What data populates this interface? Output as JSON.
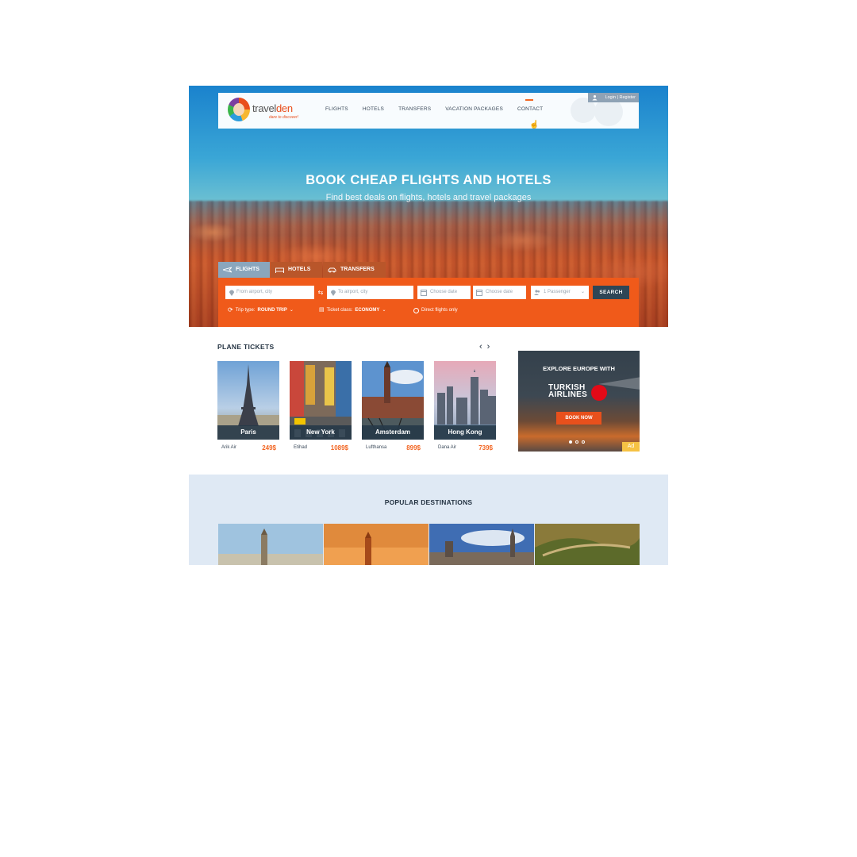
{
  "brand": {
    "name_part1": "travel",
    "name_part2": "den",
    "tagline": "dare to discover!"
  },
  "nav": {
    "items": [
      {
        "label": "FLIGHTS"
      },
      {
        "label": "HOTELS"
      },
      {
        "label": "TRANSFERS"
      },
      {
        "label": "VACATION PACKAGES"
      },
      {
        "label": "CONTACT",
        "active": true
      }
    ],
    "login_label": "Login  |  Register"
  },
  "hero": {
    "title": "BOOK CHEAP FLIGHTS AND HOTELS",
    "subtitle": "Find best deals on flights, hotels and travel packages"
  },
  "search": {
    "tabs": [
      {
        "label": "FLIGHTS",
        "icon": "plane-icon",
        "active": true
      },
      {
        "label": "HOTELS",
        "icon": "bed-icon"
      },
      {
        "label": "TRANSFERS",
        "icon": "car-icon"
      }
    ],
    "from_placeholder": "From airport, city",
    "to_placeholder": "To airport, city",
    "depart_placeholder": "Choose date",
    "return_placeholder": "Choose date",
    "passengers": "1 Passenger",
    "search_label": "SEARCH",
    "trip_type_label": "Trip type:",
    "trip_type_value": "ROUND TRIP",
    "ticket_class_label": "Ticket class:",
    "ticket_class_value": "ECONOMY",
    "direct_label": "Direct flights only",
    "accent": "#f05a1a"
  },
  "plane_tickets": {
    "title": "PLANE TICKETS",
    "cards": [
      {
        "city": "Paris",
        "airline": "Arik Air",
        "price": "249$"
      },
      {
        "city": "New York",
        "airline": "Etihad",
        "price": "1089$"
      },
      {
        "city": "Amsterdam",
        "airline": "Lufthansa",
        "price": "899$"
      },
      {
        "city": "Hong Kong",
        "airline": "Dana Air",
        "price": "739$"
      }
    ]
  },
  "ad": {
    "headline": "EXPLORE EUROPE WITH",
    "brand_line1": "TURKISH",
    "brand_line2": "AIRLINES",
    "button": "BOOK NOW",
    "tag": "Ad"
  },
  "popular": {
    "title": "POPULAR DESTINATIONS"
  }
}
